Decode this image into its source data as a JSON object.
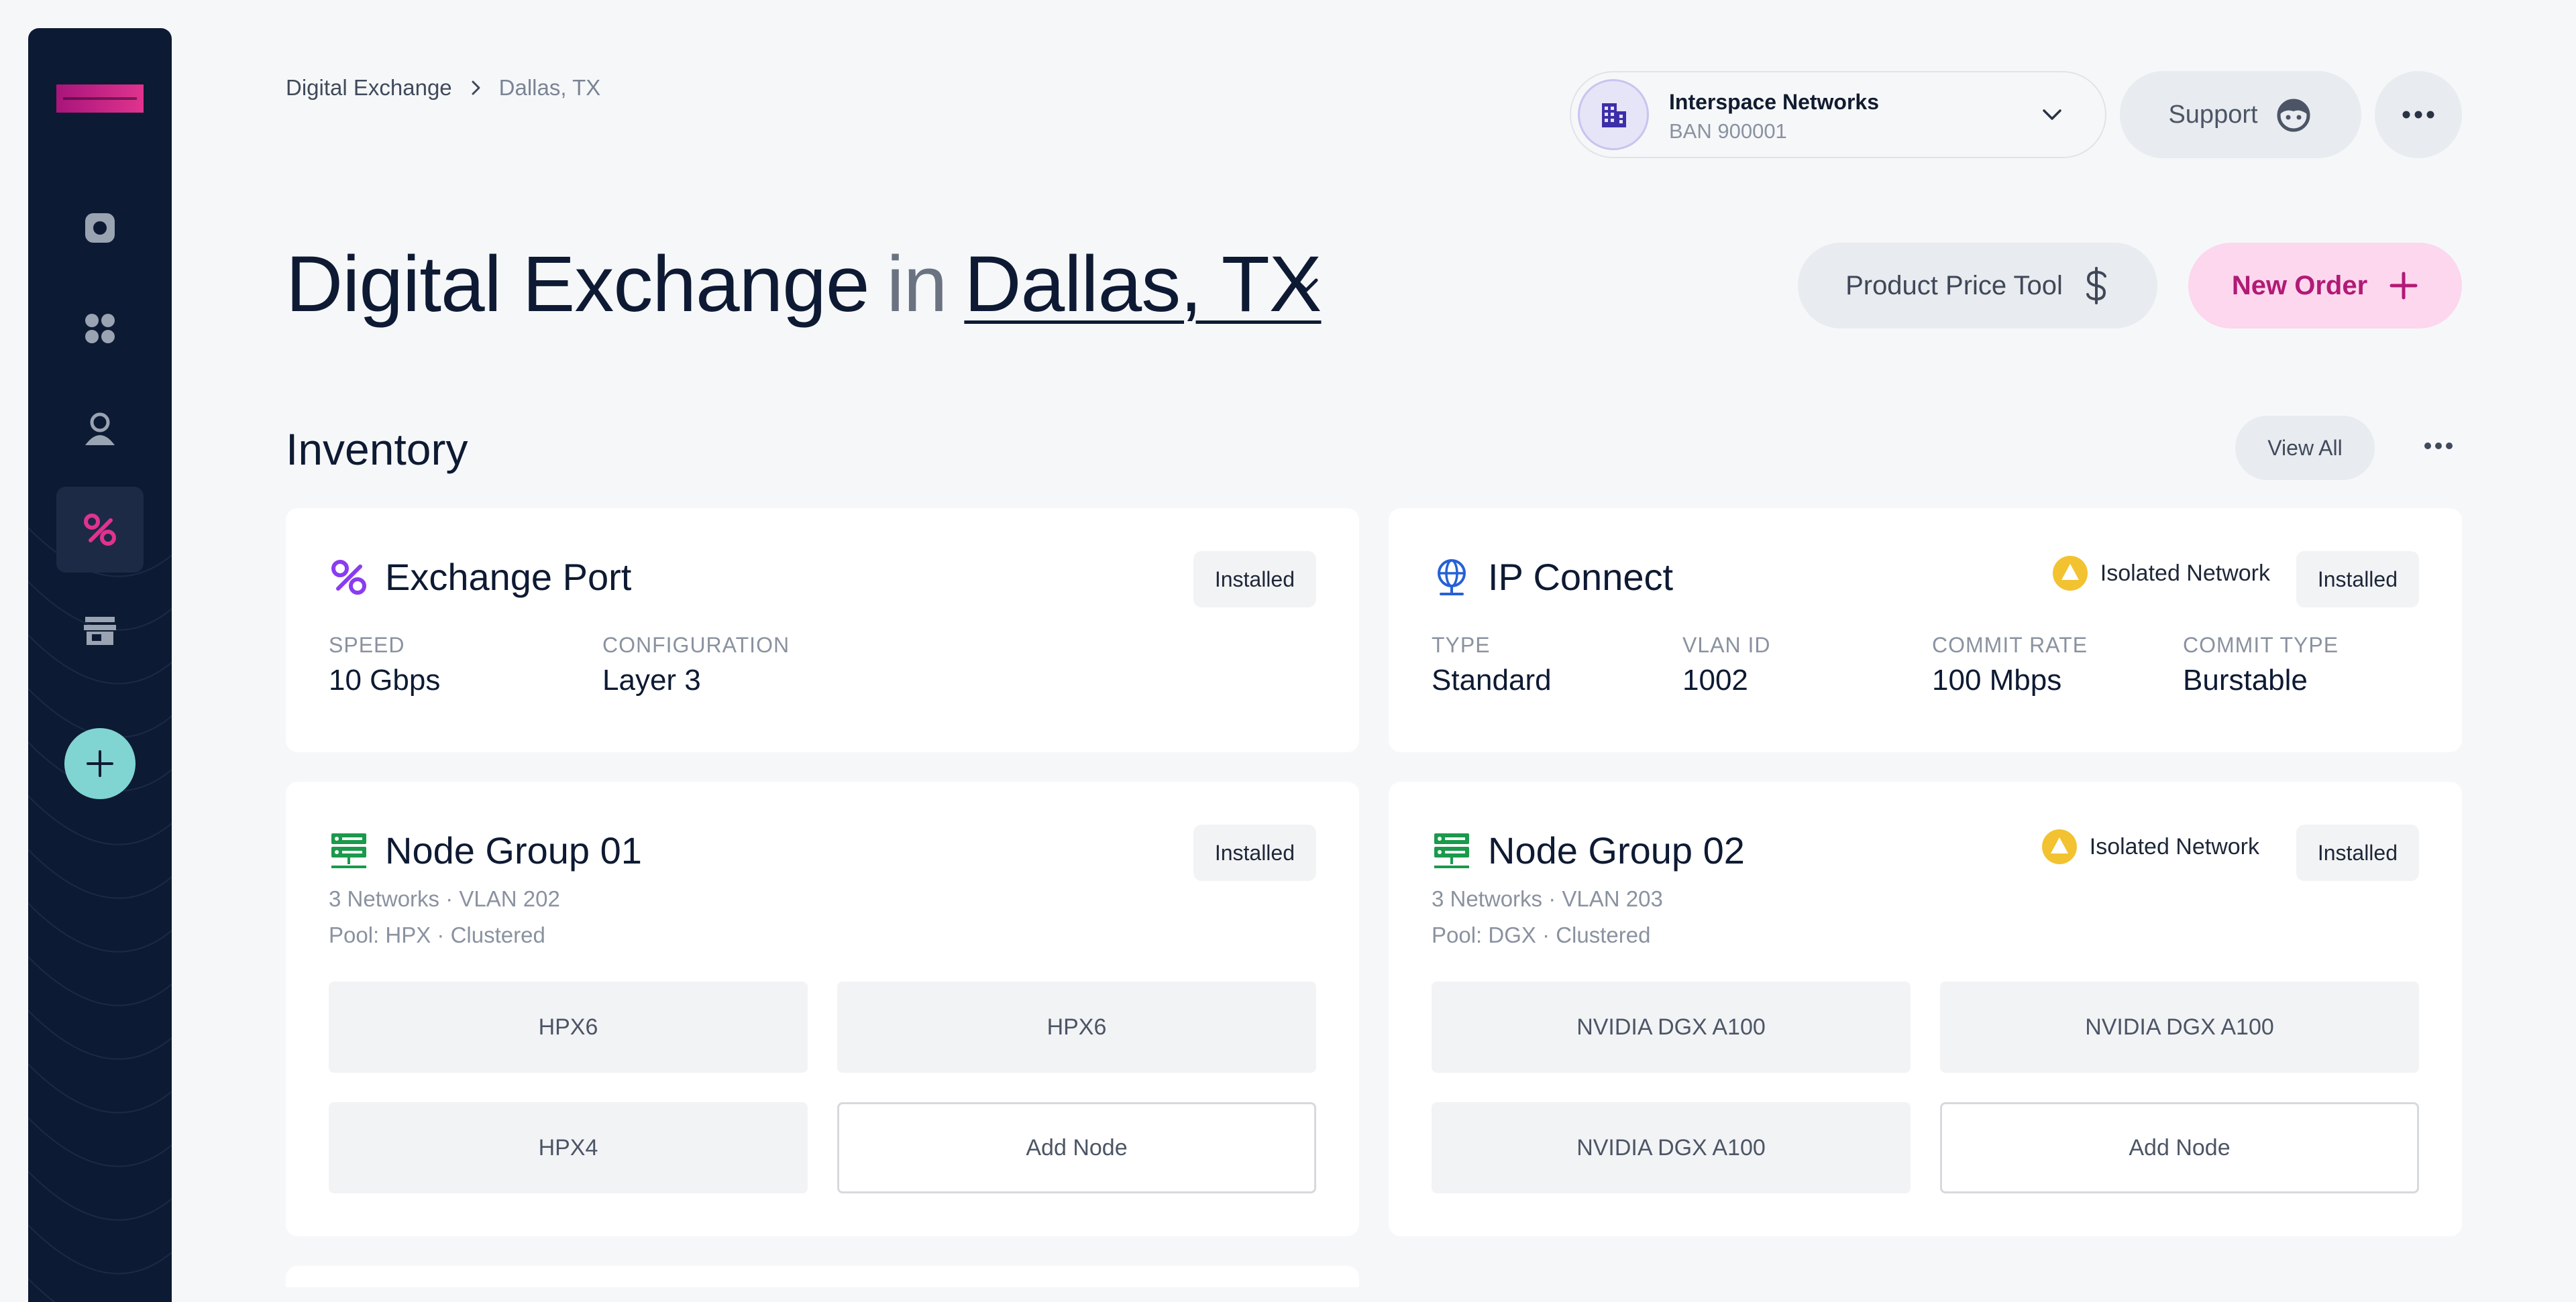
{
  "breadcrumb": {
    "root": "Digital Exchange",
    "current": "Dallas, TX"
  },
  "account": {
    "name": "Interspace Networks",
    "ban": "BAN 900001"
  },
  "support": {
    "label": "Support"
  },
  "heading": {
    "product": "Digital Exchange",
    "connector": "in",
    "location": "Dallas, TX"
  },
  "actions": {
    "price_tool": "Product Price Tool",
    "new_order": "New Order"
  },
  "inventory": {
    "title": "Inventory",
    "view_all": "View All",
    "exchange_port": {
      "title": "Exchange Port",
      "status": "Installed",
      "fields": [
        {
          "label": "SPEED",
          "value": "10 Gbps"
        },
        {
          "label": "CONFIGURATION",
          "value": "Layer 3"
        }
      ]
    },
    "ip_connect": {
      "title": "IP Connect",
      "warning": "Isolated Network",
      "status": "Installed",
      "fields": [
        {
          "label": "TYPE",
          "value": "Standard"
        },
        {
          "label": "VLAN ID",
          "value": "1002"
        },
        {
          "label": "COMMIT RATE",
          "value": "100 Mbps"
        },
        {
          "label": "COMMIT TYPE",
          "value": "Burstable"
        }
      ]
    },
    "node_group_01": {
      "title": "Node Group 01",
      "status": "Installed",
      "meta_line1": "3 Networks  ·  VLAN 202",
      "meta_line2": "Pool: HPX ·  Clustered",
      "nodes": [
        "HPX6",
        "HPX6",
        "HPX4"
      ],
      "add_label": "Add Node"
    },
    "node_group_02": {
      "title": "Node Group 02",
      "warning": "Isolated Network",
      "status": "Installed",
      "meta_line1": "3 Networks  ·  VLAN 203",
      "meta_line2": "Pool: DGX ·  Clustered",
      "nodes": [
        "NVIDIA DGX A100",
        "NVIDIA DGX A100",
        "NVIDIA DGX A100"
      ],
      "add_label": "Add Node"
    }
  },
  "colors": {
    "sidebar": "#0d1a33",
    "accent_pink": "#e0338f",
    "fab": "#80d4d2",
    "warning": "#f2c230",
    "server_green": "#1a9a4a"
  },
  "icons": {
    "nav": [
      "record-icon",
      "apps-grid-icon",
      "user-icon",
      "exchange-link-icon",
      "storefront-icon"
    ],
    "fab": "plus-icon"
  }
}
